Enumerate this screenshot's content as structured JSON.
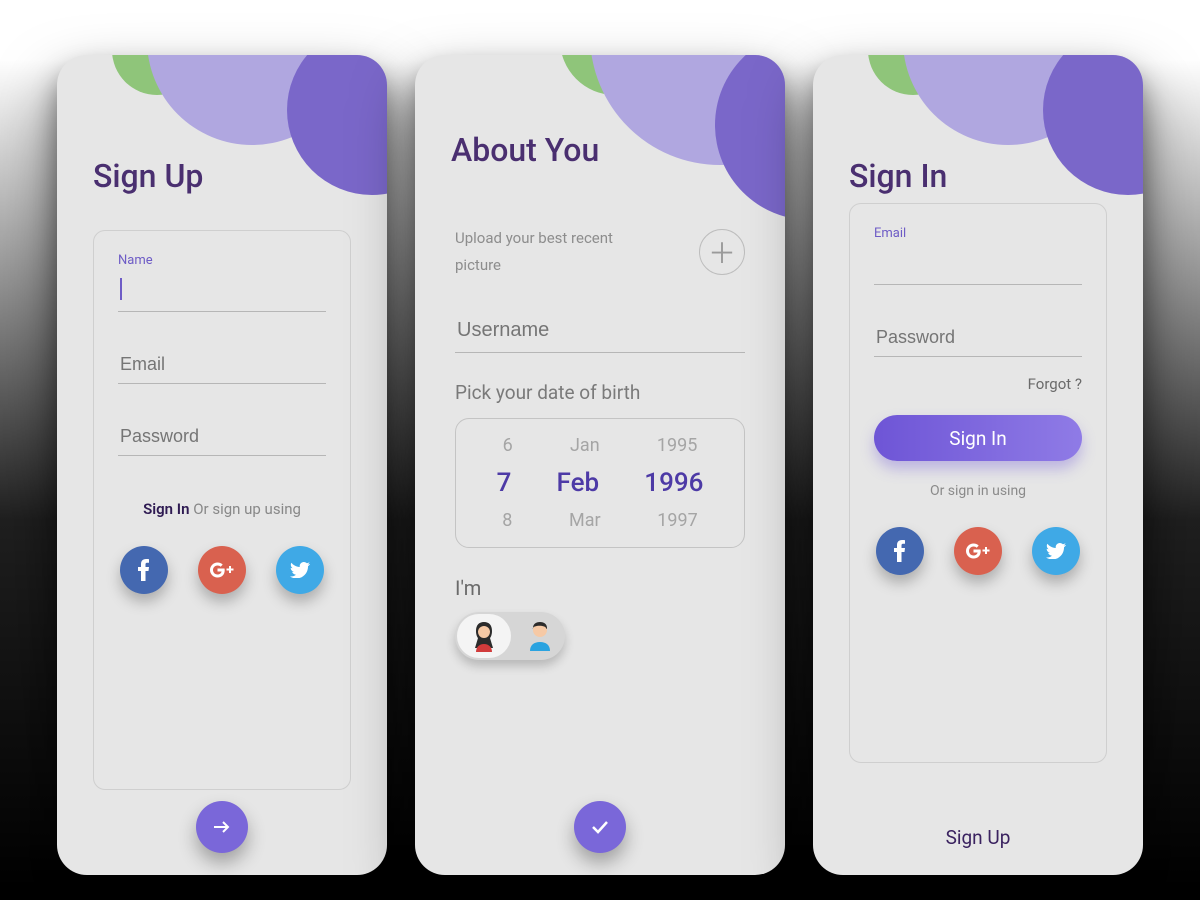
{
  "signup": {
    "title": "Sign Up",
    "name_label": "Name",
    "email_label": "Email",
    "password_label": "Password",
    "signin_link": "Sign In",
    "or_text": "Or sign up using"
  },
  "about": {
    "title": "About You",
    "upload_text": "Upload your best recent picture",
    "username_label": "Username",
    "dob_label": "Pick your date of birth",
    "dob_prev": {
      "d": "6",
      "m": "Jan",
      "y": "1995"
    },
    "dob_sel": {
      "d": "7",
      "m": "Feb",
      "y": "1996"
    },
    "dob_next": {
      "d": "8",
      "m": "Mar",
      "y": "1997"
    },
    "im_label": "I'm"
  },
  "signin": {
    "title": "Sign In",
    "email_label": "Email",
    "password_label": "Password",
    "forgot": "Forgot ?",
    "button": "Sign In",
    "or_text": "Or sign in using",
    "signup_link": "Sign Up"
  }
}
